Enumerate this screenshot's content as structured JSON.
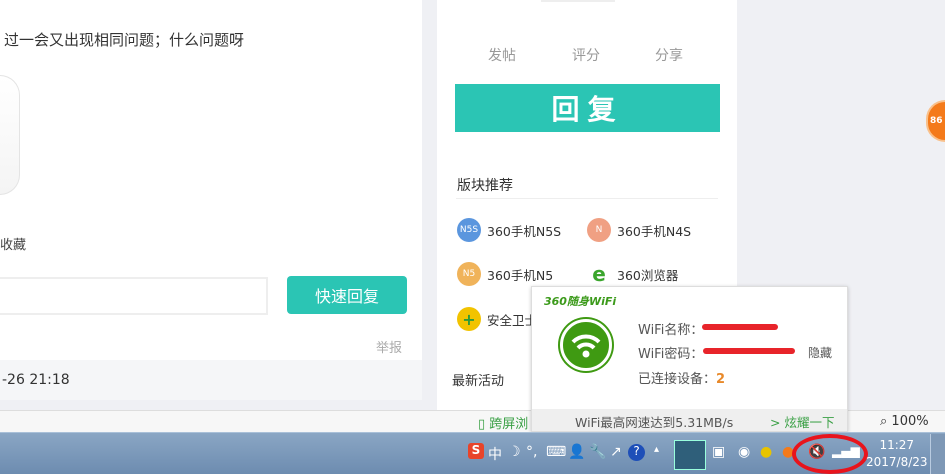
{
  "post": {
    "text": "过一会又出现相同问题；什么问题呀",
    "favorite": "收藏",
    "quick_reply": "快速回复",
    "report": "举报",
    "date": "-26 21:18"
  },
  "sidebar": {
    "actions": [
      "发帖",
      "评分",
      "分享"
    ],
    "reply": "回复",
    "section_title": "版块推荐",
    "forums": [
      {
        "label": "360手机N5S",
        "icon": "N5S",
        "color": "#5b96de"
      },
      {
        "label": "360手机N4S",
        "icon": "N",
        "color": "#f0a083"
      },
      {
        "label": "360手机N5",
        "icon": "N5",
        "color": "#f0b35a"
      },
      {
        "label": "360浏览器",
        "icon": "e",
        "color": "#3aa52c"
      },
      {
        "label": "安全卫士",
        "icon": "+",
        "color": "#f2c300"
      }
    ],
    "latest": "最新活动"
  },
  "floating_badge": "86",
  "statusbar": {
    "cross_screen": "跨屏浏",
    "zoom": "100%"
  },
  "wifi_popup": {
    "brand": "360随身WiFi",
    "name_label": "WiFi名称：",
    "password_label": "WiFi密码：",
    "hide": "隐藏",
    "devices_label": "已连接设备：",
    "devices_count": "2",
    "speed": "WiFi最高网速达到5.31MB/s",
    "show_off": "> 炫耀一下"
  },
  "taskbar": {
    "ime": "中",
    "time": "11:27",
    "date": "2017/8/23"
  }
}
